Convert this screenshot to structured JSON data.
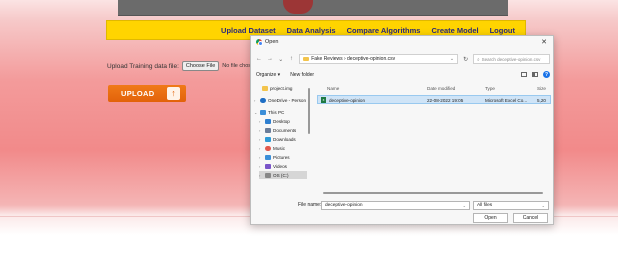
{
  "nav": {
    "links": [
      "Upload Dataset",
      "Data Analysis",
      "Compare Algorithms",
      "Create Model",
      "Logout"
    ]
  },
  "form": {
    "label": "Upload Training data file:",
    "choose_file_label": "Choose File",
    "no_file_text": "No file chos",
    "upload_label": "UPLOAD"
  },
  "dialog": {
    "title": "Open",
    "breadcrumb": "Fake Reviews  ›  deceptive-opinion.csv",
    "search_placeholder": "Search deceptive-opinion.csv",
    "organize_label": "Organize ▾",
    "new_folder_label": "New folder",
    "nav_items": [
      {
        "label": "project.img",
        "color": "#f3c44c"
      },
      {
        "label": "OneDrive - Person",
        "color": "#1f6fc5"
      },
      {
        "label": "This PC",
        "color": "#3b8ed8"
      },
      {
        "label": "Desktop",
        "color": "#2f7fd0"
      },
      {
        "label": "Documents",
        "color": "#6b7d9a"
      },
      {
        "label": "Downloads",
        "color": "#2e9ad6"
      },
      {
        "label": "Music",
        "color": "#e2584c"
      },
      {
        "label": "Pictures",
        "color": "#3c8fd8"
      },
      {
        "label": "Videos",
        "color": "#7a55c9"
      },
      {
        "label": "OS (C:)",
        "color": "#888888"
      }
    ],
    "columns": {
      "name": "Name",
      "date": "Date modified",
      "type": "Type",
      "size": "Size"
    },
    "files": [
      {
        "name": "deceptive-opinion",
        "date": "22-08-2022 19:05",
        "type": "Microsoft Excel Co...",
        "size": "5,20"
      }
    ],
    "file_name_label": "File name:",
    "file_name_value": "deceptive-opinion",
    "file_type": "All files",
    "open_label": "Open",
    "cancel_label": "Cancel",
    "close_glyph": "✕"
  },
  "colors": {
    "nav_bg": "#ffd400",
    "nav_text": "#2b2b7a",
    "upload_bg": "#f07a18",
    "selection": "#cfe4f7"
  }
}
